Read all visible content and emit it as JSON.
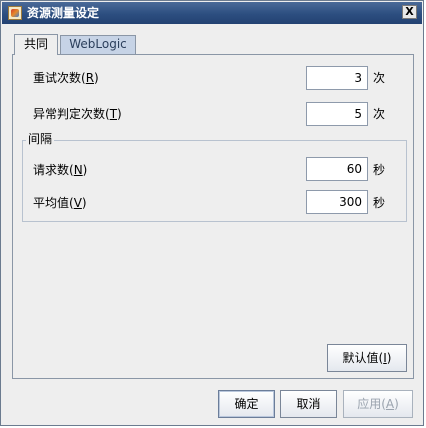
{
  "window": {
    "title": "资源测量设定",
    "close_label": "X"
  },
  "tabs": [
    {
      "label": "共同"
    },
    {
      "label": "WebLogic"
    }
  ],
  "common": {
    "retry": {
      "label": "重试次数(",
      "mnemonic": "R",
      "suffix": ")",
      "value": "3",
      "unit": "次"
    },
    "abnormal": {
      "label": "异常判定次数(",
      "mnemonic": "T",
      "suffix": ")",
      "value": "5",
      "unit": "次"
    },
    "interval_group": {
      "title": "间隔",
      "requests": {
        "label": "请求数(",
        "mnemonic": "N",
        "suffix": ")",
        "value": "60",
        "unit": "秒"
      },
      "average": {
        "label": "平均值(",
        "mnemonic": "V",
        "suffix": ")",
        "value": "300",
        "unit": "秒"
      }
    },
    "default_button": {
      "label": "默认值(",
      "mnemonic": "I",
      "suffix": ")"
    }
  },
  "footer": {
    "ok": "确定",
    "cancel": "取消",
    "apply": {
      "label": "应用(",
      "mnemonic": "A",
      "suffix": ")"
    }
  }
}
